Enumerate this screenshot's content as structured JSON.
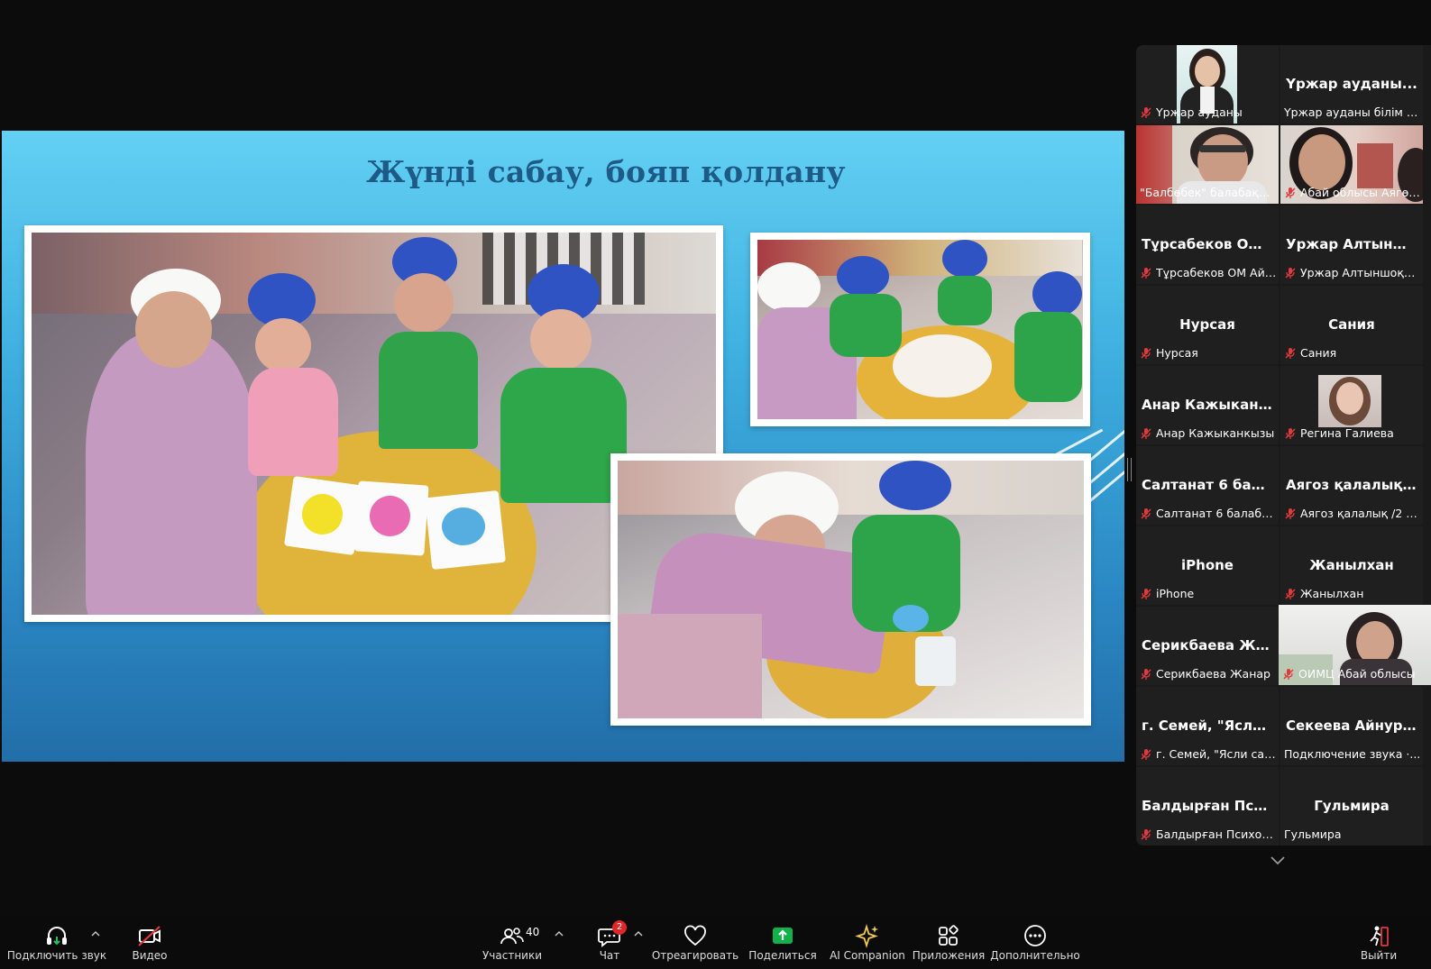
{
  "slide": {
    "title": "Жүнді сабау, бояп қолдану"
  },
  "participants": [
    {
      "display": "",
      "label": "Үржар ауданы",
      "muted": true,
      "video": true
    },
    {
      "display": "Үржар ауданы...",
      "label": "Үржар ауданы білім бе...",
      "muted": false,
      "video": false
    },
    {
      "display": "",
      "label": "\"Балбөбек\" балабақша...",
      "muted": false,
      "video": true,
      "active": true
    },
    {
      "display": "",
      "label": "Абай облысы Аягөз ...",
      "muted": true,
      "video": true
    },
    {
      "display": "Тұрсабеков ОМ...",
      "label": "Тұрсабеков ОМ Айт...",
      "muted": true,
      "video": false
    },
    {
      "display": "Уржар Алтынш...",
      "label": "Уржар Алтыншоқы ...",
      "muted": true,
      "video": false
    },
    {
      "display": "Нурсая",
      "label": "Нурсая",
      "muted": true,
      "video": false
    },
    {
      "display": "Сания",
      "label": "Сания",
      "muted": true,
      "video": false
    },
    {
      "display": "Анар Кажыкан...",
      "label": "Анар Кажыканкызы",
      "muted": true,
      "video": false
    },
    {
      "display": "",
      "label": "Регина Галиева",
      "muted": true,
      "video": true
    },
    {
      "display": "Салтанат 6 бал...",
      "label": "Салтанат 6 балабак...",
      "muted": true,
      "video": false
    },
    {
      "display": "Аягоз қалалық...",
      "label": "Аягоз қалалық /2 ба...",
      "muted": true,
      "video": false
    },
    {
      "display": "iPhone",
      "label": "iPhone",
      "muted": true,
      "video": false
    },
    {
      "display": "Жанылхан",
      "label": "Жанылхан",
      "muted": true,
      "video": false
    },
    {
      "display": "Серикбаева Жа...",
      "label": "Серикбаева Жанар",
      "muted": true,
      "video": false
    },
    {
      "display": "",
      "label": "ОИМЦ Абай облысы",
      "muted": true,
      "video": true
    },
    {
      "display": "г. Семей, \"Ясли...",
      "label": "г. Семей, \"Ясли сад\"...",
      "muted": true,
      "video": false
    },
    {
      "display": "Секеева Айнур...",
      "label": "Подключение звука ·...",
      "muted": false,
      "video": false
    },
    {
      "display": "Балдырған Пси...",
      "label": "Балдырған Психолог...",
      "muted": true,
      "video": false
    },
    {
      "display": "Гульмира",
      "label": "Гульмира",
      "muted": false,
      "video": false
    }
  ],
  "toolbar": {
    "audio": "Подключить звук",
    "video": "Видео",
    "participants": "Участники",
    "participants_count": "40",
    "chat": "Чат",
    "chat_badge": "2",
    "react": "Отреагировать",
    "share": "Поделиться",
    "ai": "AI Companion",
    "apps": "Приложения",
    "more": "Дополнительно",
    "leave": "Выйти"
  },
  "colors": {
    "share_green": "#12b24a",
    "active_speaker": "#23d96b",
    "mute_red": "#e0393e"
  }
}
